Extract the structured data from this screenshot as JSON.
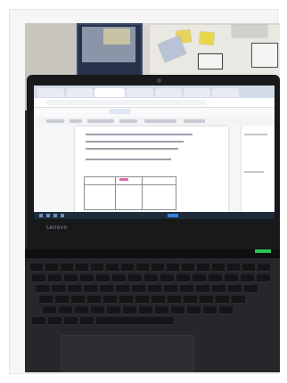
{
  "laptop": {
    "brand_label": "Lenovo"
  },
  "browser": {
    "tab_count": 7,
    "active_tab_index": 2
  },
  "colors": {
    "share_button": "#dfe6f5",
    "highlight": "#e06aa8",
    "taskbar": "#1d2b3a",
    "power_led": "#2fc35a"
  }
}
